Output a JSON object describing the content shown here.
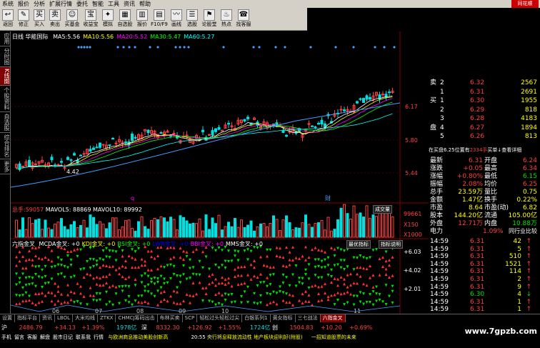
{
  "menu": [
    "系统",
    "报价",
    "分析",
    "扩展行情",
    "委托",
    "智能",
    "工具",
    "资讯",
    "帮助"
  ],
  "logo_text": "同花顺",
  "toolbar": [
    {
      "icon": "↩",
      "label": "返回"
    },
    {
      "icon": "✎",
      "label": "修正"
    },
    {
      "icon": "买",
      "label": "买入"
    },
    {
      "icon": "卖",
      "label": "卖出"
    },
    {
      "icon": "☺",
      "label": "买基金"
    },
    {
      "icon": "宝",
      "label": "收益宝"
    },
    {
      "icon": "✦",
      "label": "模拟"
    },
    {
      "icon": "▦",
      "label": "自选股"
    },
    {
      "icon": "▥",
      "label": "报价"
    },
    {
      "icon": "▤",
      "label": "F10/F9"
    },
    {
      "icon": "〰",
      "label": "画线"
    },
    {
      "icon": "☰",
      "label": "选股"
    },
    {
      "icon": "⚑",
      "label": "论股堂"
    },
    {
      "icon": "♨",
      "label": "热点"
    },
    {
      "icon": "☎",
      "label": "找客服"
    }
  ],
  "left_tabs": [
    "应用",
    "分时图",
    "K线图",
    "个股资料",
    "自选股",
    "综合排名",
    "更多"
  ],
  "chart": {
    "period": "日线",
    "stock": "华能国际",
    "ma": [
      {
        "k": "MA5:",
        "v": "5.56"
      },
      {
        "k": "MA10:",
        "v": "5.56"
      },
      {
        "k": "MA20:",
        "v": "5.52"
      },
      {
        "k": "MA30:",
        "v": "5.47"
      },
      {
        "k": "MA60:",
        "v": "5.27"
      }
    ],
    "prices": [
      "6.17",
      "5.80",
      "5.44"
    ],
    "low_label": "4.42",
    "volume": {
      "label": "总手:",
      "v": "59057",
      "ma5": "MAVOL5: 88869",
      "ma10": "MAVOL10: 89992"
    },
    "vol_axis": [
      "99661",
      "X150",
      "X1000"
    ],
    "vol_btn": "成交量",
    "indicator": {
      "name": "六指金叉",
      "items": [
        "MCDA金叉: +0",
        "KDJ金叉: +0",
        "RSI金叉: +0",
        "LWR金叉: +0",
        "BBI金叉: +0",
        "MMS金叉: +0"
      ],
      "btn1": "最优指标",
      "btn2": "指标说明",
      "axis": [
        "+6.03",
        "+4.02",
        "+2.01"
      ]
    },
    "months": [
      "06",
      "07",
      "08",
      "09",
      "10",
      "11"
    ],
    "mark_q": "q",
    "mark_cai": "财"
  },
  "order_book": [
    {
      "side": "卖",
      "n": "2",
      "p": "6.32",
      "v": "2567"
    },
    {
      "side": "",
      "n": "1",
      "p": "6.31",
      "v": "2691"
    },
    {
      "side": "买",
      "n": "1",
      "p": "6.30",
      "v": "1955"
    },
    {
      "side": "",
      "n": "2",
      "p": "6.29",
      "v": "818"
    },
    {
      "side": "",
      "n": "3",
      "p": "6.28",
      "v": "4183"
    },
    {
      "side": "盘",
      "n": "4",
      "p": "6.27",
      "v": "1894"
    },
    {
      "side": "",
      "n": "5",
      "p": "6.26",
      "v": "813"
    }
  ],
  "bid_info": {
    "a": "在买盘6.25位置有",
    "b": "2334手",
    "c": "买单↓查看详细"
  },
  "stats": [
    {
      "k": "最新",
      "v": "6.31",
      "k2": "开盘",
      "v2": "6.24"
    },
    {
      "k": "涨跌",
      "v": "+0.05",
      "k2": "最高",
      "v2": "6.34"
    },
    {
      "k": "涨幅",
      "v": "+0.80%",
      "k2": "最低",
      "v2": "6.15"
    },
    {
      "k": "振幅",
      "v": "2.08%",
      "k2": "均价",
      "v2": "6.25"
    },
    {
      "k": "总手",
      "v": "23.59万",
      "k2": "量比",
      "v2": "0.75"
    },
    {
      "k": "金额",
      "v": "1.47亿",
      "k2": "换手",
      "v2": "0.22%"
    },
    {
      "k": "市盈",
      "v": "8.64",
      "k2": "市盈(动)",
      "v2": "6.82"
    },
    {
      "k": "股本",
      "v": "144.20亿",
      "k2": "流通",
      "v2": "105.00亿"
    },
    {
      "k": "外盘",
      "v": "12.71万",
      "k2": "内盘",
      "v2": "10.88万"
    }
  ],
  "industry": {
    "k": "电力",
    "v": "1.09%",
    "btn": "同行业比较"
  },
  "ticks": [
    {
      "t": "14:59",
      "p": "6.31",
      "v": "42",
      "a": "↑"
    },
    {
      "t": "14:59",
      "p": "6.31",
      "v": "5",
      "a": "↑"
    },
    {
      "t": "14:59",
      "p": "6.31",
      "v": "510",
      "a": "↑"
    },
    {
      "t": "14:59",
      "p": "6.31",
      "v": "1521",
      "a": "↑"
    },
    {
      "t": "14:59",
      "p": "6.31",
      "v": "114",
      "a": "↑"
    },
    {
      "t": "14:59",
      "p": "6.31",
      "v": "2",
      "a": "↑"
    },
    {
      "t": "14:59",
      "p": "6.31",
      "v": "9",
      "a": "↑"
    },
    {
      "t": "14:59",
      "p": "6.30",
      "v": "4",
      "a": "↓"
    },
    {
      "t": "14:59",
      "p": "6.31",
      "v": "1",
      "a": "↑"
    },
    {
      "t": "14:59",
      "p": "6.31",
      "v": "1",
      "a": "↑"
    }
  ],
  "bottom_tabs": [
    "设置",
    "指标平台",
    "资讯",
    "LBOL",
    "大米均线",
    "ZTKX",
    "CHMCJ筹码出击",
    "布林买卖",
    "SCP",
    "轻松过头轻松过尖",
    "白银系列1",
    "黄女指标",
    "三七战法",
    "六指金叉"
  ],
  "index": {
    "sh": "沪",
    "sh_val": "2486.79",
    "sh_chg": "+34.13",
    "sh_pct": "+1.39%",
    "sh_amt": "1978亿",
    "sz": "深",
    "sz_val": "8332.30",
    "sz_chg": "+126.92",
    "sz_pct": "+1.55%",
    "sz_amt": "1724亿",
    "cy": "创",
    "cy_val": "1504.83",
    "cy_chg": "+10.20",
    "cy_pct": "+0.69%"
  },
  "news_left": [
    "手机",
    "留言",
    "客服",
    "解盘",
    "股市日记",
    "联系我",
    "行情"
  ],
  "news": "与欧洲商息推动美股创新高",
  "news_time": "20:55",
  "news2": "央行将息释放流动性 地产板块迎利好(附股)",
  "news3": "一招知道股票的未来",
  "watermark": "www.7gpzb.com"
}
